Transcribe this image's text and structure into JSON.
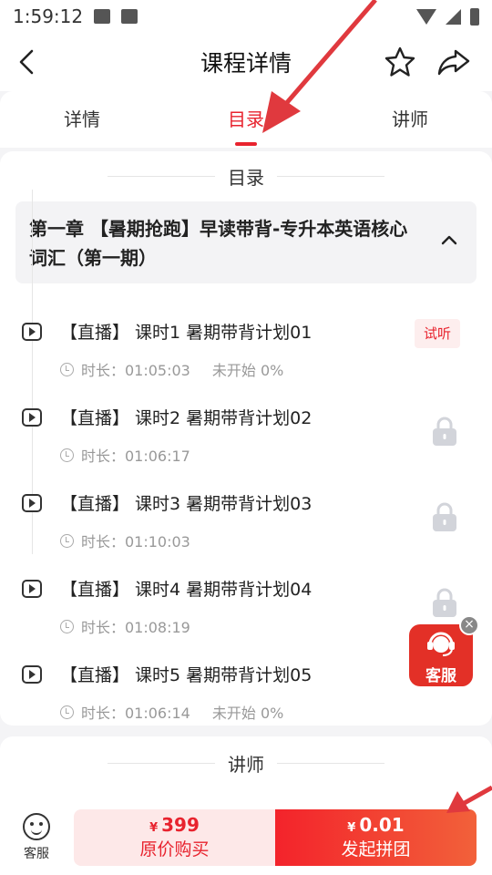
{
  "status_bar": {
    "time": "1:59:12"
  },
  "nav": {
    "title": "课程详情"
  },
  "tabs": [
    {
      "label": "详情"
    },
    {
      "label": "目录"
    },
    {
      "label": "讲师"
    }
  ],
  "catalog": {
    "heading": "目录",
    "chapter_title": "第一章 【暑期抢跑】早读带背-专升本英语核心词汇（第一期）",
    "lessons": [
      {
        "title": "【直播】 课时1 暑期带背计划01",
        "duration": "时长：01:05:03",
        "status": "未开始 0%",
        "badge": "试听"
      },
      {
        "title": "【直播】 课时2 暑期带背计划02",
        "duration": "时长：01:06:17"
      },
      {
        "title": "【直播】 课时3 暑期带背计划03",
        "duration": "时长：01:10:03"
      },
      {
        "title": "【直播】 课时4 暑期带背计划04",
        "duration": "时长：01:08:19"
      },
      {
        "title": "【直播】 课时5 暑期带背计划05",
        "duration": "时长：01:06:14",
        "status": "未开始 0%"
      }
    ]
  },
  "teacher": {
    "heading": "讲师"
  },
  "float_service": {
    "label": "客服"
  },
  "bottom": {
    "cs_label": "客服",
    "buy_currency": "¥",
    "buy_price": "399",
    "buy_label": "原价购买",
    "group_currency": "¥",
    "group_price": "0.01",
    "group_label": "发起拼团"
  },
  "colors": {
    "accent": "#e8232e",
    "float_bg": "#e33027"
  }
}
